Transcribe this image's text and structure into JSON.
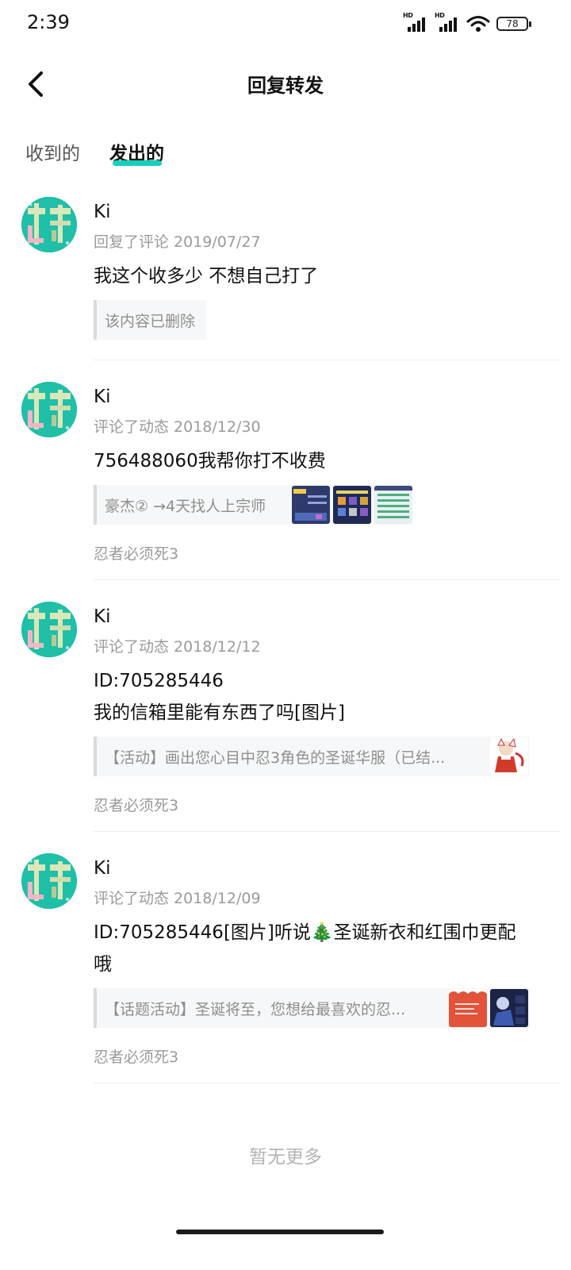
{
  "status_bar": {
    "time": "2:39",
    "battery": "78",
    "signal_label": "HD"
  },
  "header": {
    "title": "回复转发",
    "back_icon": "chevron-left-icon"
  },
  "tabs": [
    {
      "label": "收到的",
      "active": false
    },
    {
      "label": "发出的",
      "active": true
    }
  ],
  "accent_color": "#17cfba",
  "items": [
    {
      "name": "Ki",
      "meta": "回复了评论 2019/07/27",
      "text": "我这个收多少 不想自己打了",
      "quote": "该内容已删除",
      "source": ""
    },
    {
      "name": "Ki",
      "meta": "评论了动态 2018/12/30",
      "text": "756488060我帮你打不收费",
      "quote": "豪杰② →4天找人上宗师",
      "source": "忍者必须死3"
    },
    {
      "name": "Ki",
      "meta": "评论了动态 2018/12/12",
      "text_lines": [
        "ID:705285446",
        "我的信箱里能有东西了吗[图片]"
      ],
      "quote": "【活动】画出您心目中忍3角色的圣诞华服（已结...",
      "source": "忍者必须死3"
    },
    {
      "name": "Ki",
      "meta": "评论了动态 2018/12/09",
      "text_lines": [
        "ID:705285446[图片]听说🎄圣诞新衣和红围巾更配",
        "哦"
      ],
      "quote": "【话题活动】圣诞将至，您想给最喜欢的忍...",
      "source": "忍者必须死3"
    }
  ],
  "footer": {
    "no_more": "暂无更多"
  }
}
